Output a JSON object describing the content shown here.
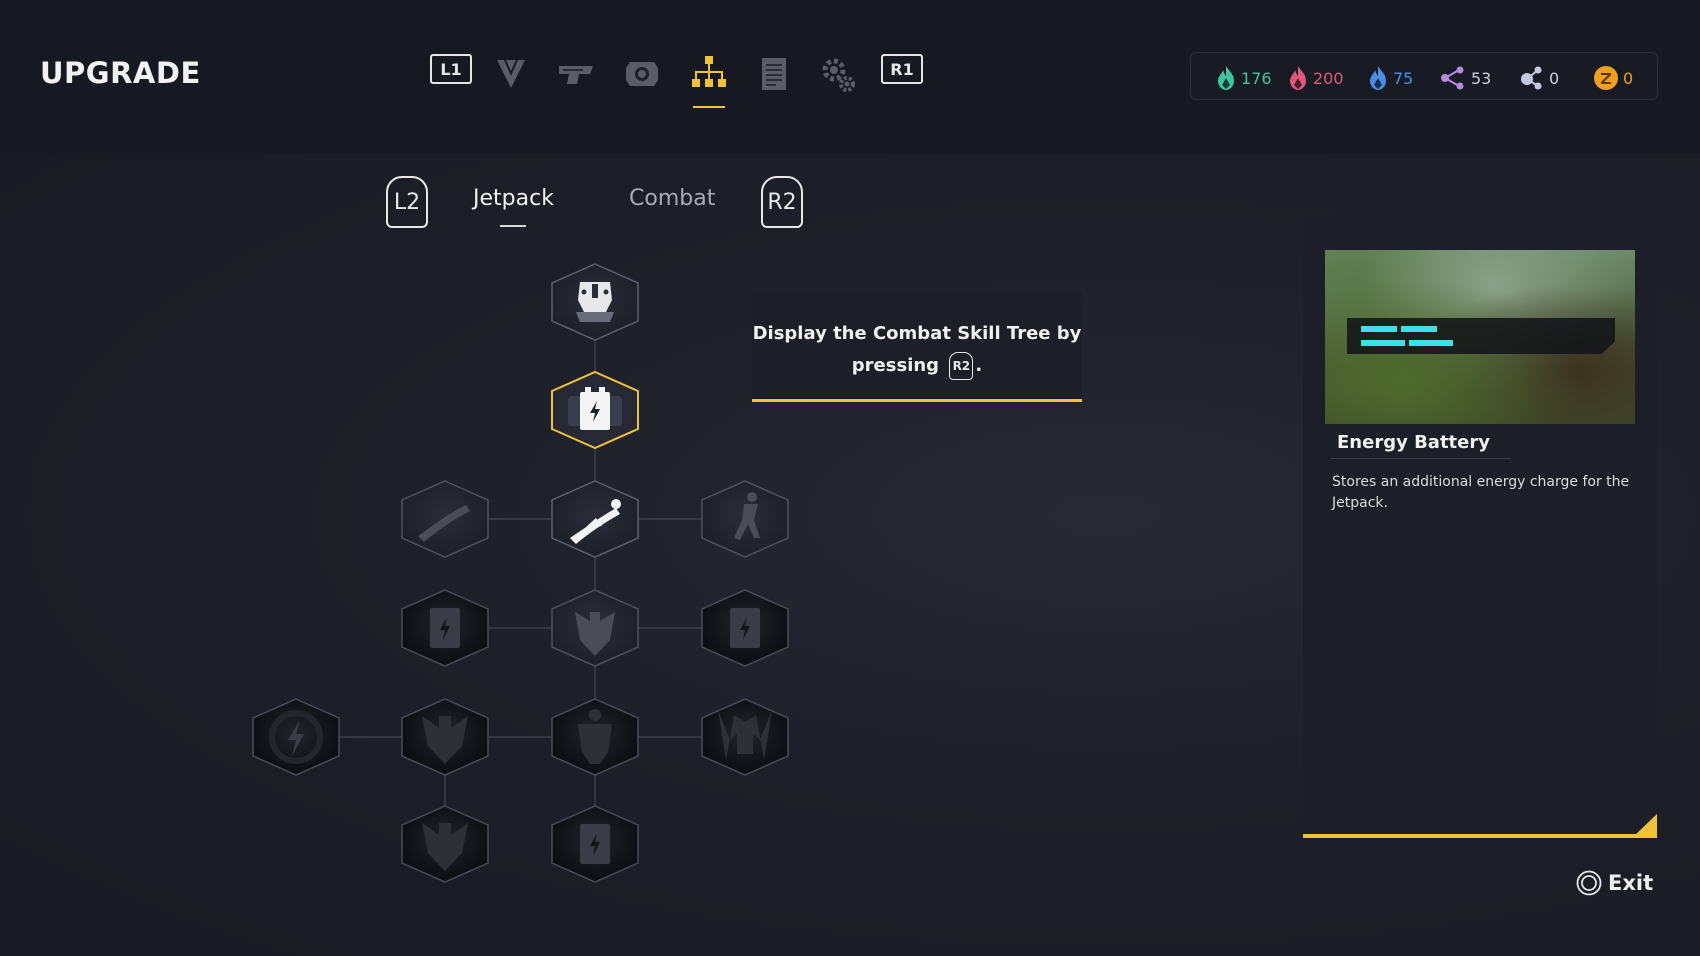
{
  "header": {
    "title": "UPGRADE",
    "nav": [
      {
        "type": "key",
        "label": "L1",
        "icon": "l1-button-icon"
      },
      {
        "type": "icon",
        "icon": "chevron-emblem-icon"
      },
      {
        "type": "icon",
        "icon": "weapon-icon"
      },
      {
        "type": "icon",
        "icon": "module-icon"
      },
      {
        "type": "icon",
        "icon": "skill-tree-icon",
        "active": true
      },
      {
        "type": "icon",
        "icon": "document-icon"
      },
      {
        "type": "icon",
        "icon": "settings-gear-icon"
      },
      {
        "type": "key",
        "label": "R1",
        "icon": "r1-button-icon"
      }
    ]
  },
  "currencies": [
    {
      "icon": "green-flame-icon",
      "value": "176",
      "color": "#3fc6a0"
    },
    {
      "icon": "red-flame-icon",
      "value": "200",
      "color": "#e0577a"
    },
    {
      "icon": "blue-flame-icon",
      "value": "75",
      "color": "#4a8ee6"
    },
    {
      "icon": "purple-nodes-icon",
      "value": "53",
      "color": "#b58ae0"
    },
    {
      "icon": "gray-nodes-icon",
      "value": "0",
      "color": "#c4c8e0"
    },
    {
      "icon": "gold-coin-icon",
      "value": "0",
      "color": "#f0a020"
    }
  ],
  "subtabs": {
    "prev_key": "L2",
    "next_key": "R2",
    "items": [
      {
        "label": "Jetpack",
        "active": true
      },
      {
        "label": "Combat",
        "active": false
      }
    ]
  },
  "hint": {
    "line1": "Display the Combat Skill Tree by",
    "line2_prefix": "pressing",
    "key": "R2",
    "line2_suffix": "."
  },
  "skill_tree": {
    "nodes": [
      {
        "id": "core",
        "icon": "jetpack-core-icon",
        "state": "unlocked"
      },
      {
        "id": "energy-battery-1",
        "icon": "battery-icon",
        "state": "selected"
      },
      {
        "id": "dash-left",
        "icon": "dash-icon",
        "state": "available"
      },
      {
        "id": "glide",
        "icon": "glide-icon",
        "state": "unlocked"
      },
      {
        "id": "boost-right",
        "icon": "boost-icon",
        "state": "available"
      },
      {
        "id": "battery-left",
        "icon": "battery-icon",
        "state": "locked"
      },
      {
        "id": "wings-center",
        "icon": "wings-icon",
        "state": "available"
      },
      {
        "id": "battery-right",
        "icon": "battery-icon",
        "state": "locked"
      },
      {
        "id": "energy-far-left",
        "icon": "energy-bolt-icon",
        "state": "locked"
      },
      {
        "id": "wings-left",
        "icon": "wings-icon",
        "state": "locked"
      },
      {
        "id": "armor-center",
        "icon": "armor-icon",
        "state": "locked"
      },
      {
        "id": "armor-right",
        "icon": "armor-icon",
        "state": "locked"
      },
      {
        "id": "wings-bottom",
        "icon": "wings-icon",
        "state": "locked"
      },
      {
        "id": "battery-bottom",
        "icon": "battery-icon",
        "state": "locked"
      }
    ]
  },
  "info_panel": {
    "item_name": "Energy Battery",
    "description": "Stores an additional energy charge for the Jetpack."
  },
  "footer": {
    "exit_label": "Exit",
    "exit_icon": "circle-button-icon"
  },
  "colors": {
    "accent": "#f0c23a",
    "background": "#1a1c26",
    "panel": "#1c1e28"
  }
}
